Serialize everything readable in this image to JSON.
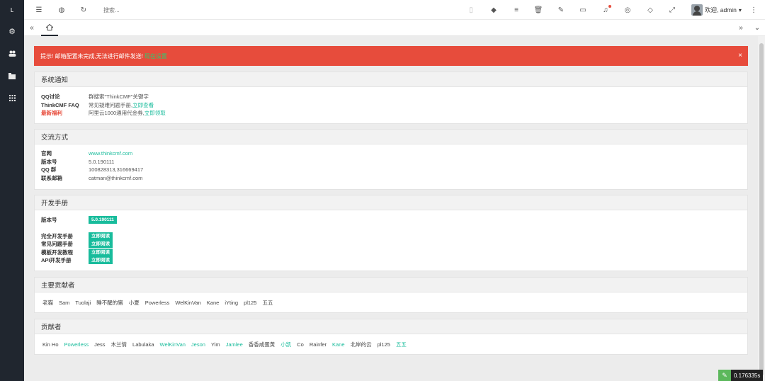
{
  "sidebar": {
    "items": [
      {
        "icon": "logo-icon",
        "glyph": "ʟ"
      },
      {
        "icon": "cogs-icon",
        "glyph": "⚙"
      },
      {
        "icon": "users-icon",
        "glyph": "👥"
      },
      {
        "icon": "folder-open-icon",
        "glyph": "▬"
      },
      {
        "icon": "grid-icon",
        "glyph": "▦"
      }
    ]
  },
  "topbar": {
    "search_placeholder": "搜索...",
    "user_greeting": "欢迎, admin",
    "caret": "▾",
    "more": "⋮"
  },
  "alert": {
    "text": "提示! 邮箱配置未完成,无法进行邮件发送!",
    "link": "现在设置",
    "close": "×"
  },
  "notice": {
    "title": "系统通知",
    "rows": [
      {
        "key": "QQ讨论",
        "value": "群搜索\"ThinkCMF\"关键字",
        "link": ""
      },
      {
        "key": "ThinkCMF FAQ",
        "value": "常见疑难问题手册,",
        "link": "立即查看"
      },
      {
        "key": "最新福利",
        "value": "阿里云1000通用代金券,",
        "link": "立即领取"
      }
    ]
  },
  "contact": {
    "title": "交流方式",
    "rows": [
      {
        "key": "官网",
        "value": "www.thinkcmf.com"
      },
      {
        "key": "版本号",
        "value": "5.0.190111"
      },
      {
        "key": "QQ 群",
        "value": "100828313,316669417"
      },
      {
        "key": "联系邮箱",
        "value": "catman@thinkcmf.com"
      }
    ]
  },
  "manual": {
    "title": "开发手册",
    "version_key": "版本号",
    "version_value": "5.0.190111",
    "rows": [
      {
        "key": "完全开发手册",
        "button": "立即阅读"
      },
      {
        "key": "常见问题手册",
        "button": "立即阅读"
      },
      {
        "key": "模板开发教程",
        "button": "立即阅读"
      },
      {
        "key": "API开发手册",
        "button": "立即阅读"
      }
    ]
  },
  "main_contributors": {
    "title": "主要贡献者",
    "names": [
      "老猫",
      "Sam",
      "Tuolaji",
      "睡不醒的猪",
      "小夏",
      "Powerless",
      "WelKinVan",
      "Kane",
      "iYting",
      "pl125",
      "五五"
    ]
  },
  "contributors": {
    "title": "贡献者",
    "names": [
      {
        "name": "Kin Ho",
        "hl": false
      },
      {
        "name": "Powerless",
        "hl": true
      },
      {
        "name": "Jess",
        "hl": false
      },
      {
        "name": "木兰情",
        "hl": false
      },
      {
        "name": "Labulaka",
        "hl": false
      },
      {
        "name": "WelKinVan",
        "hl": true
      },
      {
        "name": "Jeson",
        "hl": true
      },
      {
        "name": "Yim",
        "hl": false
      },
      {
        "name": "Jamlee",
        "hl": true
      },
      {
        "name": "香香咸蛋黄",
        "hl": false
      },
      {
        "name": "小凯",
        "hl": true
      },
      {
        "name": "Co",
        "hl": false
      },
      {
        "name": "Rainfer",
        "hl": false
      },
      {
        "name": "Kane",
        "hl": true
      },
      {
        "name": "北岸的云",
        "hl": false
      },
      {
        "name": "pl125",
        "hl": false
      },
      {
        "name": "五五",
        "hl": true
      }
    ]
  },
  "timer": {
    "value": "0.176335s"
  },
  "colors": {
    "alert": "#e74c3c",
    "accent": "#1abc9c",
    "sidebar": "#20262f"
  }
}
